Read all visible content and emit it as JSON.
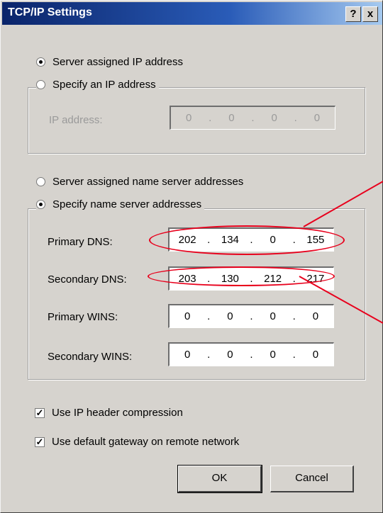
{
  "title": "TCP/IP Settings",
  "titlebar_buttons": {
    "help": "?",
    "close": "x"
  },
  "ip_section": {
    "server_assigned": "Server assigned IP address",
    "specify": "Specify an IP address",
    "ip_label": "IP address:",
    "ip_value": [
      "0",
      "0",
      "0",
      "0"
    ]
  },
  "dns_section": {
    "server_assigned": "Server assigned name server addresses",
    "specify": "Specify name server addresses",
    "primary_dns_label": "Primary DNS:",
    "primary_dns": [
      "202",
      "134",
      "0",
      "155"
    ],
    "secondary_dns_label": "Secondary DNS:",
    "secondary_dns": [
      "203",
      "130",
      "212",
      "217"
    ],
    "primary_wins_label": "Primary WINS:",
    "primary_wins": [
      "0",
      "0",
      "0",
      "0"
    ],
    "secondary_wins_label": "Secondary WINS:",
    "secondary_wins": [
      "0",
      "0",
      "0",
      "0"
    ]
  },
  "options": {
    "ip_header_compression": "Use IP header compression",
    "default_gateway": "Use default gateway on remote network"
  },
  "buttons": {
    "ok": "OK",
    "cancel": "Cancel"
  },
  "colors": {
    "annotation": "#e8001c",
    "title_bar": "#0a246a"
  }
}
